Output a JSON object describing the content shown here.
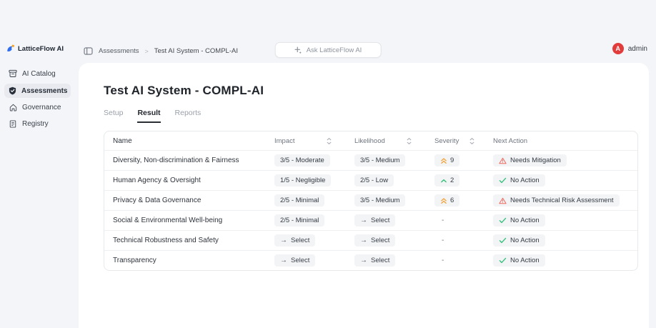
{
  "app": {
    "logo_text": "LatticeFlow AI"
  },
  "sidebar": {
    "items": [
      {
        "label": "AI Catalog",
        "icon": "ai-catalog-icon",
        "active": false
      },
      {
        "label": "Assessments",
        "icon": "assessments-shield-icon",
        "active": true
      },
      {
        "label": "Governance",
        "icon": "governance-home-icon",
        "active": false
      },
      {
        "label": "Registry",
        "icon": "registry-icon",
        "active": false
      }
    ]
  },
  "header": {
    "breadcrumb": [
      "Assessments",
      "Test AI System - COMPL-AI"
    ],
    "ask_button_label": "Ask LatticeFlow AI",
    "user": {
      "initial": "A",
      "name": "admin"
    }
  },
  "icons": {
    "select_arrow": "→",
    "breadcrumb_separator": ">"
  },
  "main": {
    "title": "Test AI System - COMPL-AI",
    "tabs": [
      {
        "label": "Setup",
        "active": false
      },
      {
        "label": "Result",
        "active": true
      },
      {
        "label": "Reports",
        "active": false
      }
    ],
    "table": {
      "columns": [
        "Name",
        "Impact",
        "Likelihood",
        "Severity",
        "Next Action"
      ],
      "rows": [
        {
          "name": "Diversity, Non-discrimination & Fairness",
          "impact": {
            "kind": "pill",
            "text": "3/5 - Moderate"
          },
          "likelihood": {
            "kind": "pill",
            "text": "3/5 - Medium"
          },
          "severity": {
            "kind": "badge",
            "value": "9",
            "level": "high"
          },
          "next_action": {
            "kind": "warning",
            "text": "Needs Mitigation"
          }
        },
        {
          "name": "Human Agency & Oversight",
          "impact": {
            "kind": "pill",
            "text": "1/5 - Negligible"
          },
          "likelihood": {
            "kind": "pill",
            "text": "2/5 - Low"
          },
          "severity": {
            "kind": "badge",
            "value": "2",
            "level": "low"
          },
          "next_action": {
            "kind": "ok",
            "text": "No Action"
          }
        },
        {
          "name": "Privacy & Data Governance",
          "impact": {
            "kind": "pill",
            "text": "2/5 - Minimal"
          },
          "likelihood": {
            "kind": "pill",
            "text": "3/5 - Medium"
          },
          "severity": {
            "kind": "badge",
            "value": "6",
            "level": "high"
          },
          "next_action": {
            "kind": "warning",
            "text": "Needs Technical Risk Assessment"
          }
        },
        {
          "name": "Social & Environmental Well-being",
          "impact": {
            "kind": "pill",
            "text": "2/5 - Minimal"
          },
          "likelihood": {
            "kind": "select",
            "text": "Select"
          },
          "severity": {
            "kind": "dash",
            "value": "-"
          },
          "next_action": {
            "kind": "ok",
            "text": "No Action"
          }
        },
        {
          "name": "Technical Robustness and Safety",
          "impact": {
            "kind": "select",
            "text": "Select"
          },
          "likelihood": {
            "kind": "select",
            "text": "Select"
          },
          "severity": {
            "kind": "dash",
            "value": "-"
          },
          "next_action": {
            "kind": "ok",
            "text": "No Action"
          }
        },
        {
          "name": "Transparency",
          "impact": {
            "kind": "select",
            "text": "Select"
          },
          "likelihood": {
            "kind": "select",
            "text": "Select"
          },
          "severity": {
            "kind": "dash",
            "value": "-"
          },
          "next_action": {
            "kind": "ok",
            "text": "No Action"
          }
        }
      ]
    }
  },
  "colors": {
    "page_bg": "#f4f5f8",
    "card_bg": "#ffffff",
    "active_nav_bg": "#e8eaef",
    "pill_bg": "#f3f4f6",
    "avatar_red": "#e23b3b",
    "severity_high_orange": "#f0a43c",
    "severity_low_green": "#2fbe76",
    "warning_coral": "#ed6a5e",
    "check_green": "#34c07a",
    "logo_blue": "#2f6fed",
    "logo_orange": "#f6a21e"
  }
}
